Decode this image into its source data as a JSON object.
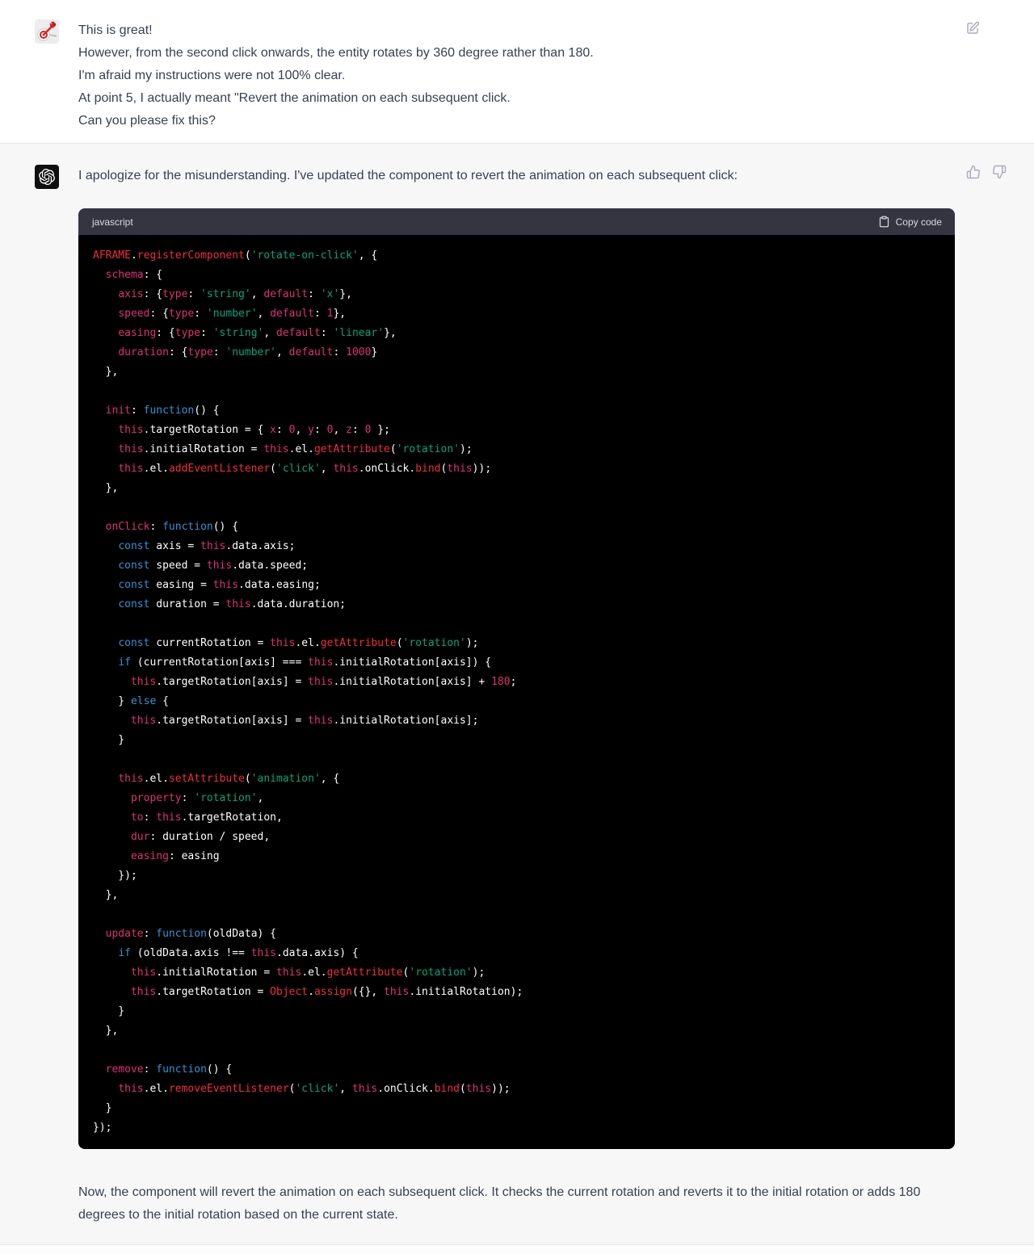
{
  "colors": {
    "page_bg": "#ffffff",
    "assistant_bg": "#f7f7f8",
    "section_border": "#e5e5e6",
    "body_text": "#374151",
    "code_header_bg": "#343541",
    "code_header_text": "#d9d9e3",
    "code_bg": "#000000",
    "icon_gray": "#acacbe",
    "avatar_bot_bg": "#0f0f0f",
    "avatar_user_bg": "#ededf0"
  },
  "icons": {
    "edit": "edit-icon",
    "thumbs_up": "thumbs-up-icon",
    "thumbs_down": "thumbs-down-icon",
    "copy": "clipboard-icon",
    "assistant_avatar": "openai-logo-icon",
    "user_avatar": "dart-target-avatar"
  },
  "user_message": {
    "lines": [
      "This is great!",
      "However, from the second click onwards, the entity rotates by 360 degree rather than 180.",
      "I'm afraid my instructions were not 100% clear.",
      "At point 5, I actually meant \"Revert the animation on each subsequent click.",
      "Can you please fix this?"
    ]
  },
  "assistant_message": {
    "intro": "I apologize for the misunderstanding. I've updated the component to revert the animation on each subsequent click:",
    "outro": "Now, the component will revert the animation on each subsequent click. It checks the current rotation and reverts it to the initial rotation or adds 180 degrees to the initial rotation based on the current state."
  },
  "code_block": {
    "language_label": "javascript",
    "copy_button_label": "Copy code",
    "palette": {
      "w": "#ffffff",
      "pink": "#df3079",
      "blue": "#2e95d3",
      "green": "#00a67d",
      "red": "#f22c3d"
    },
    "lines": [
      [
        [
          "red",
          "AFRAME"
        ],
        [
          "w",
          "."
        ],
        [
          "red",
          "registerComponent"
        ],
        [
          "w",
          "("
        ],
        [
          "green",
          "'rotate-on-click'"
        ],
        [
          "w",
          ", {"
        ]
      ],
      [
        [
          "w",
          "  "
        ],
        [
          "pink",
          "schema"
        ],
        [
          "w",
          ": {"
        ]
      ],
      [
        [
          "w",
          "    "
        ],
        [
          "pink",
          "axis"
        ],
        [
          "w",
          ": {"
        ],
        [
          "pink",
          "type"
        ],
        [
          "w",
          ": "
        ],
        [
          "green",
          "'string'"
        ],
        [
          "w",
          ", "
        ],
        [
          "pink",
          "default"
        ],
        [
          "w",
          ": "
        ],
        [
          "green",
          "'x'"
        ],
        [
          "w",
          "},"
        ]
      ],
      [
        [
          "w",
          "    "
        ],
        [
          "pink",
          "speed"
        ],
        [
          "w",
          ": {"
        ],
        [
          "pink",
          "type"
        ],
        [
          "w",
          ": "
        ],
        [
          "green",
          "'number'"
        ],
        [
          "w",
          ", "
        ],
        [
          "pink",
          "default"
        ],
        [
          "w",
          ": "
        ],
        [
          "pink",
          "1"
        ],
        [
          "w",
          "},"
        ]
      ],
      [
        [
          "w",
          "    "
        ],
        [
          "pink",
          "easing"
        ],
        [
          "w",
          ": {"
        ],
        [
          "pink",
          "type"
        ],
        [
          "w",
          ": "
        ],
        [
          "green",
          "'string'"
        ],
        [
          "w",
          ", "
        ],
        [
          "pink",
          "default"
        ],
        [
          "w",
          ": "
        ],
        [
          "green",
          "'linear'"
        ],
        [
          "w",
          "},"
        ]
      ],
      [
        [
          "w",
          "    "
        ],
        [
          "pink",
          "duration"
        ],
        [
          "w",
          ": {"
        ],
        [
          "pink",
          "type"
        ],
        [
          "w",
          ": "
        ],
        [
          "green",
          "'number'"
        ],
        [
          "w",
          ", "
        ],
        [
          "pink",
          "default"
        ],
        [
          "w",
          ": "
        ],
        [
          "pink",
          "1000"
        ],
        [
          "w",
          "}"
        ]
      ],
      [
        [
          "w",
          "  },"
        ]
      ],
      [],
      [
        [
          "w",
          "  "
        ],
        [
          "pink",
          "init"
        ],
        [
          "w",
          ": "
        ],
        [
          "blue",
          "function"
        ],
        [
          "w",
          "() {"
        ]
      ],
      [
        [
          "w",
          "    "
        ],
        [
          "pink",
          "this"
        ],
        [
          "w",
          ".targetRotation = { "
        ],
        [
          "pink",
          "x"
        ],
        [
          "w",
          ": "
        ],
        [
          "pink",
          "0"
        ],
        [
          "w",
          ", "
        ],
        [
          "pink",
          "y"
        ],
        [
          "w",
          ": "
        ],
        [
          "pink",
          "0"
        ],
        [
          "w",
          ", "
        ],
        [
          "pink",
          "z"
        ],
        [
          "w",
          ": "
        ],
        [
          "pink",
          "0"
        ],
        [
          "w",
          " };"
        ]
      ],
      [
        [
          "w",
          "    "
        ],
        [
          "pink",
          "this"
        ],
        [
          "w",
          ".initialRotation = "
        ],
        [
          "pink",
          "this"
        ],
        [
          "w",
          ".el."
        ],
        [
          "red",
          "getAttribute"
        ],
        [
          "w",
          "("
        ],
        [
          "green",
          "'rotation'"
        ],
        [
          "w",
          ");"
        ]
      ],
      [
        [
          "w",
          "    "
        ],
        [
          "pink",
          "this"
        ],
        [
          "w",
          ".el."
        ],
        [
          "red",
          "addEventListener"
        ],
        [
          "w",
          "("
        ],
        [
          "green",
          "'click'"
        ],
        [
          "w",
          ", "
        ],
        [
          "pink",
          "this"
        ],
        [
          "w",
          ".onClick."
        ],
        [
          "red",
          "bind"
        ],
        [
          "w",
          "("
        ],
        [
          "pink",
          "this"
        ],
        [
          "w",
          "));"
        ]
      ],
      [
        [
          "w",
          "  },"
        ]
      ],
      [],
      [
        [
          "w",
          "  "
        ],
        [
          "pink",
          "onClick"
        ],
        [
          "w",
          ": "
        ],
        [
          "blue",
          "function"
        ],
        [
          "w",
          "() {"
        ]
      ],
      [
        [
          "w",
          "    "
        ],
        [
          "blue",
          "const"
        ],
        [
          "w",
          " axis = "
        ],
        [
          "pink",
          "this"
        ],
        [
          "w",
          ".data.axis;"
        ]
      ],
      [
        [
          "w",
          "    "
        ],
        [
          "blue",
          "const"
        ],
        [
          "w",
          " speed = "
        ],
        [
          "pink",
          "this"
        ],
        [
          "w",
          ".data.speed;"
        ]
      ],
      [
        [
          "w",
          "    "
        ],
        [
          "blue",
          "const"
        ],
        [
          "w",
          " easing = "
        ],
        [
          "pink",
          "this"
        ],
        [
          "w",
          ".data.easing;"
        ]
      ],
      [
        [
          "w",
          "    "
        ],
        [
          "blue",
          "const"
        ],
        [
          "w",
          " duration = "
        ],
        [
          "pink",
          "this"
        ],
        [
          "w",
          ".data.duration;"
        ]
      ],
      [],
      [
        [
          "w",
          "    "
        ],
        [
          "blue",
          "const"
        ],
        [
          "w",
          " currentRotation = "
        ],
        [
          "pink",
          "this"
        ],
        [
          "w",
          ".el."
        ],
        [
          "red",
          "getAttribute"
        ],
        [
          "w",
          "("
        ],
        [
          "green",
          "'rotation'"
        ],
        [
          "w",
          ");"
        ]
      ],
      [
        [
          "w",
          "    "
        ],
        [
          "blue",
          "if"
        ],
        [
          "w",
          " (currentRotation[axis] === "
        ],
        [
          "pink",
          "this"
        ],
        [
          "w",
          ".initialRotation[axis]) {"
        ]
      ],
      [
        [
          "w",
          "      "
        ],
        [
          "pink",
          "this"
        ],
        [
          "w",
          ".targetRotation[axis] = "
        ],
        [
          "pink",
          "this"
        ],
        [
          "w",
          ".initialRotation[axis] + "
        ],
        [
          "pink",
          "180"
        ],
        [
          "w",
          ";"
        ]
      ],
      [
        [
          "w",
          "    } "
        ],
        [
          "blue",
          "else"
        ],
        [
          "w",
          " {"
        ]
      ],
      [
        [
          "w",
          "      "
        ],
        [
          "pink",
          "this"
        ],
        [
          "w",
          ".targetRotation[axis] = "
        ],
        [
          "pink",
          "this"
        ],
        [
          "w",
          ".initialRotation[axis];"
        ]
      ],
      [
        [
          "w",
          "    }"
        ]
      ],
      [],
      [
        [
          "w",
          "    "
        ],
        [
          "pink",
          "this"
        ],
        [
          "w",
          ".el."
        ],
        [
          "red",
          "setAttribute"
        ],
        [
          "w",
          "("
        ],
        [
          "green",
          "'animation'"
        ],
        [
          "w",
          ", {"
        ]
      ],
      [
        [
          "w",
          "      "
        ],
        [
          "pink",
          "property"
        ],
        [
          "w",
          ": "
        ],
        [
          "green",
          "'rotation'"
        ],
        [
          "w",
          ","
        ]
      ],
      [
        [
          "w",
          "      "
        ],
        [
          "pink",
          "to"
        ],
        [
          "w",
          ": "
        ],
        [
          "pink",
          "this"
        ],
        [
          "w",
          ".targetRotation,"
        ]
      ],
      [
        [
          "w",
          "      "
        ],
        [
          "pink",
          "dur"
        ],
        [
          "w",
          ": duration / speed,"
        ]
      ],
      [
        [
          "w",
          "      "
        ],
        [
          "pink",
          "easing"
        ],
        [
          "w",
          ": easing"
        ]
      ],
      [
        [
          "w",
          "    });"
        ]
      ],
      [
        [
          "w",
          "  },"
        ]
      ],
      [],
      [
        [
          "w",
          "  "
        ],
        [
          "pink",
          "update"
        ],
        [
          "w",
          ": "
        ],
        [
          "blue",
          "function"
        ],
        [
          "w",
          "(oldData) {"
        ]
      ],
      [
        [
          "w",
          "    "
        ],
        [
          "blue",
          "if"
        ],
        [
          "w",
          " (oldData.axis !== "
        ],
        [
          "pink",
          "this"
        ],
        [
          "w",
          ".data.axis) {"
        ]
      ],
      [
        [
          "w",
          "      "
        ],
        [
          "pink",
          "this"
        ],
        [
          "w",
          ".initialRotation = "
        ],
        [
          "pink",
          "this"
        ],
        [
          "w",
          ".el."
        ],
        [
          "red",
          "getAttribute"
        ],
        [
          "w",
          "("
        ],
        [
          "green",
          "'rotation'"
        ],
        [
          "w",
          ");"
        ]
      ],
      [
        [
          "w",
          "      "
        ],
        [
          "pink",
          "this"
        ],
        [
          "w",
          ".targetRotation = "
        ],
        [
          "red",
          "Object"
        ],
        [
          "w",
          "."
        ],
        [
          "red",
          "assign"
        ],
        [
          "w",
          "({}, "
        ],
        [
          "pink",
          "this"
        ],
        [
          "w",
          ".initialRotation);"
        ]
      ],
      [
        [
          "w",
          "    }"
        ]
      ],
      [
        [
          "w",
          "  },"
        ]
      ],
      [],
      [
        [
          "w",
          "  "
        ],
        [
          "pink",
          "remove"
        ],
        [
          "w",
          ": "
        ],
        [
          "blue",
          "function"
        ],
        [
          "w",
          "() {"
        ]
      ],
      [
        [
          "w",
          "    "
        ],
        [
          "pink",
          "this"
        ],
        [
          "w",
          ".el."
        ],
        [
          "red",
          "removeEventListener"
        ],
        [
          "w",
          "("
        ],
        [
          "green",
          "'click'"
        ],
        [
          "w",
          ", "
        ],
        [
          "pink",
          "this"
        ],
        [
          "w",
          ".onClick."
        ],
        [
          "red",
          "bind"
        ],
        [
          "w",
          "("
        ],
        [
          "pink",
          "this"
        ],
        [
          "w",
          "));"
        ]
      ],
      [
        [
          "w",
          "  }"
        ]
      ],
      [
        [
          "w",
          "});"
        ]
      ]
    ]
  }
}
